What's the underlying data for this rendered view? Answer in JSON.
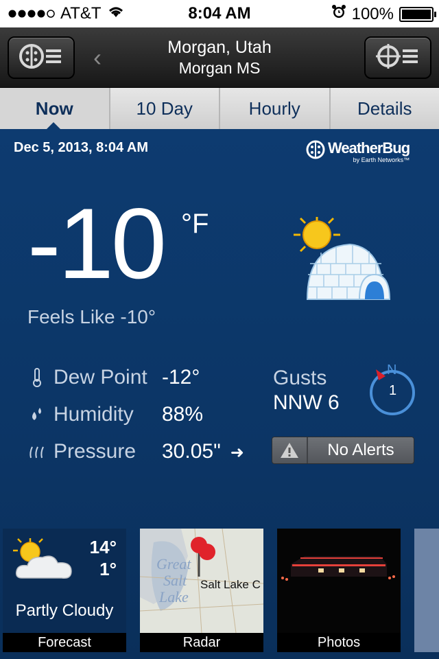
{
  "status_bar": {
    "carrier": "AT&T",
    "time": "8:04 AM",
    "battery": "100%",
    "battery_level": 1.0
  },
  "nav": {
    "title": "Morgan, Utah",
    "subtitle": "Morgan MS"
  },
  "tabs": [
    {
      "label": "Now",
      "active": true
    },
    {
      "label": "10 Day",
      "active": false
    },
    {
      "label": "Hourly",
      "active": false
    },
    {
      "label": "Details",
      "active": false
    }
  ],
  "current": {
    "date": "Dec 5, 2013, 8:04 AM",
    "temperature": "-10",
    "unit": "°F",
    "feels_like": "Feels Like -10°",
    "dew_point_label": "Dew Point",
    "dew_point": "-12°",
    "humidity_label": "Humidity",
    "humidity": "88%",
    "pressure_label": "Pressure",
    "pressure": "30.05\"",
    "gusts_label": "Gusts",
    "gusts": "NNW 6",
    "compass_dir": "N",
    "compass_value": "1",
    "alerts": "No Alerts"
  },
  "brand": {
    "name": "WeatherBug",
    "sub": "by Earth Networks™"
  },
  "tiles": {
    "forecast": {
      "high": "14°",
      "low": "1°",
      "condition": "Partly Cloudy",
      "caption": "Forecast"
    },
    "radar": {
      "caption": "Radar",
      "map_labels": [
        "Great",
        "Salt",
        "Lake"
      ],
      "city": "Salt Lake C"
    },
    "photos": {
      "caption": "Photos"
    }
  },
  "colors": {
    "panel": "#0c3564",
    "tab_text": "#0e2f5a",
    "compass_ring": "#4a90d9",
    "compass_needle": "#d9202a"
  }
}
